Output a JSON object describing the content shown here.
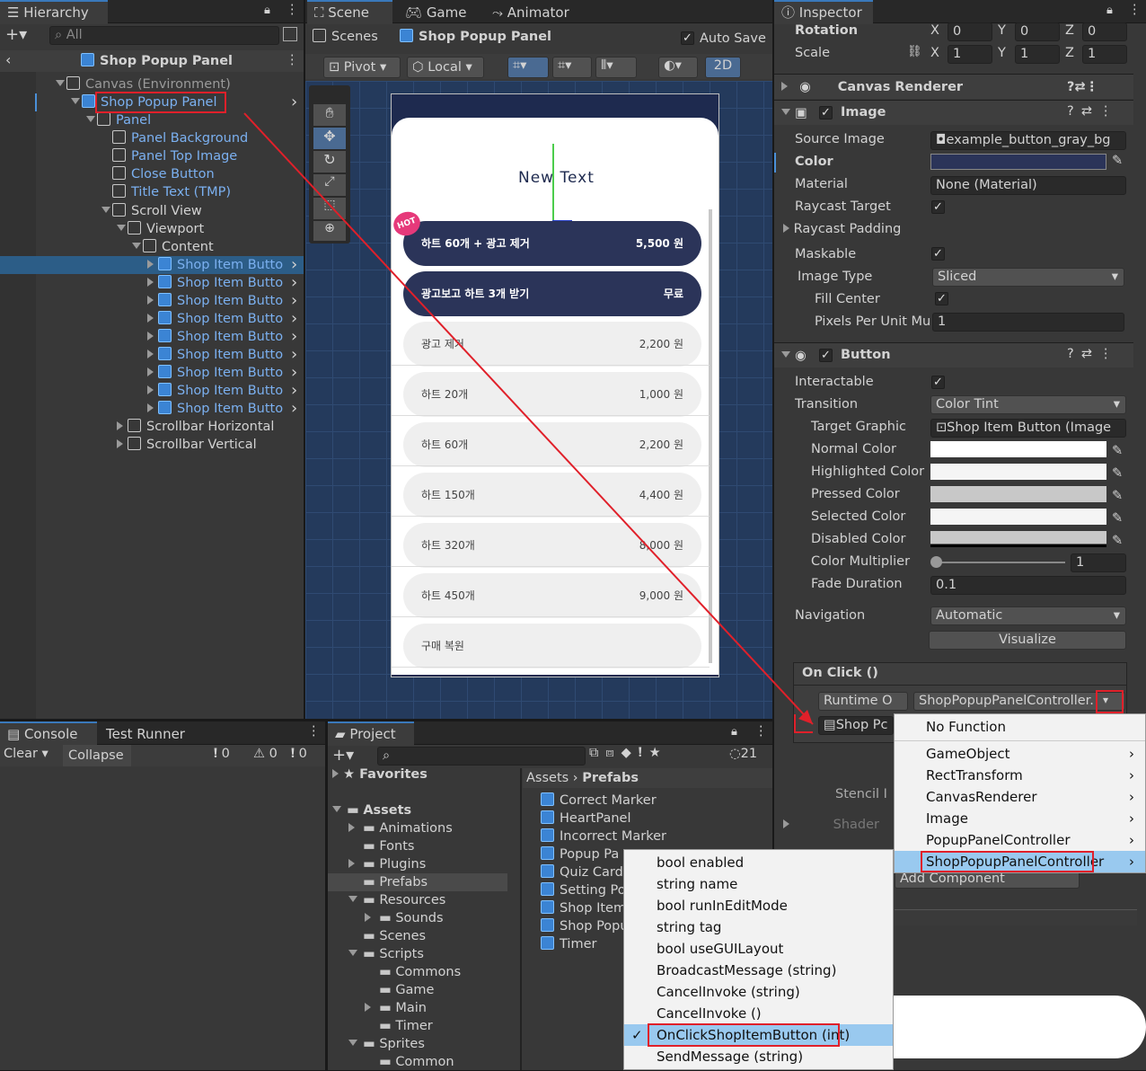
{
  "hierarchy": {
    "tab": "Hierarchy",
    "search": "All",
    "root": "Shop Popup Panel",
    "items": [
      {
        "label": "Canvas (Environment)",
        "depth": 0
      },
      {
        "label": "Shop Popup Panel",
        "depth": 1
      },
      {
        "label": "Panel",
        "depth": 2
      },
      {
        "label": "Panel Background",
        "depth": 3
      },
      {
        "label": "Panel Top Image",
        "depth": 3
      },
      {
        "label": "Close Button",
        "depth": 3
      },
      {
        "label": "Title Text (TMP)",
        "depth": 3
      },
      {
        "label": "Scroll View",
        "depth": 3
      },
      {
        "label": "Viewport",
        "depth": 4
      },
      {
        "label": "Content",
        "depth": 5
      },
      {
        "label": "Shop Item Butto",
        "depth": 6
      },
      {
        "label": "Shop Item Butto",
        "depth": 6
      },
      {
        "label": "Shop Item Butto",
        "depth": 6
      },
      {
        "label": "Shop Item Butto",
        "depth": 6
      },
      {
        "label": "Shop Item Butto",
        "depth": 6
      },
      {
        "label": "Shop Item Butto",
        "depth": 6
      },
      {
        "label": "Shop Item Butto",
        "depth": 6
      },
      {
        "label": "Shop Item Butto",
        "depth": 6
      },
      {
        "label": "Shop Item Butto",
        "depth": 6
      },
      {
        "label": "Scrollbar Horizontal",
        "depth": 4
      },
      {
        "label": "Scrollbar Vertical",
        "depth": 4
      }
    ]
  },
  "scene": {
    "tabs": [
      "Scene",
      "Game",
      "Animator"
    ],
    "breadcrumb_root": "Scenes",
    "breadcrumb": "Shop Popup Panel",
    "autosave": "Auto Save",
    "pivot": "Pivot",
    "local": "Local",
    "mode2d": "2D",
    "popup": {
      "title": "New Text",
      "badge": "HOT",
      "rows": [
        {
          "name": "하트 60개 + 광고 제거",
          "price": "5,500 원",
          "dark": true
        },
        {
          "name": "광고보고 하트 3개 받기",
          "price": "무료",
          "dark": true
        },
        {
          "name": "광고 제거",
          "price": "2,200 원",
          "dark": false
        },
        {
          "name": "하트 20개",
          "price": "1,000 원",
          "dark": false
        },
        {
          "name": "하트 60개",
          "price": "2,200 원",
          "dark": false
        },
        {
          "name": "하트 150개",
          "price": "4,400 원",
          "dark": false
        },
        {
          "name": "하트 320개",
          "price": "8,000 원",
          "dark": false
        },
        {
          "name": "하트 450개",
          "price": "9,000 원",
          "dark": false
        },
        {
          "name": "구매 복원",
          "price": "",
          "dark": false
        }
      ]
    }
  },
  "console": {
    "tabs": [
      "Console",
      "Test Runner"
    ],
    "clear": "Clear",
    "collapse": "Collapse",
    "counts": [
      "0",
      "0",
      "0"
    ]
  },
  "project": {
    "tab": "Project",
    "count": "21",
    "favorites": "Favorites",
    "path": [
      "Assets",
      "Prefabs"
    ],
    "tree": [
      {
        "label": "Assets",
        "d": 0
      },
      {
        "label": "Animations",
        "d": 1
      },
      {
        "label": "Fonts",
        "d": 1
      },
      {
        "label": "Plugins",
        "d": 1
      },
      {
        "label": "Prefabs",
        "d": 1
      },
      {
        "label": "Resources",
        "d": 1
      },
      {
        "label": "Sounds",
        "d": 2
      },
      {
        "label": "Scenes",
        "d": 1
      },
      {
        "label": "Scripts",
        "d": 1
      },
      {
        "label": "Commons",
        "d": 2
      },
      {
        "label": "Game",
        "d": 2
      },
      {
        "label": "Main",
        "d": 2
      },
      {
        "label": "Timer",
        "d": 2
      },
      {
        "label": "Sprites",
        "d": 1
      },
      {
        "label": "Common",
        "d": 2
      }
    ],
    "assets": [
      "Correct Marker",
      "HeartPanel",
      "Incorrect Marker",
      "Popup Pa",
      "Quiz Card",
      "Setting Po",
      "Shop Item",
      "Shop Popu",
      "Timer"
    ]
  },
  "inspector": {
    "tab": "Inspector",
    "rotation": {
      "label": "Rotation",
      "x": "0",
      "y": "0",
      "z": "0"
    },
    "scale": {
      "label": "Scale",
      "x": "1",
      "y": "1",
      "z": "1"
    },
    "canvas_renderer": "Canvas Renderer",
    "image": {
      "title": "Image",
      "source_label": "Source Image",
      "source": "example_button_gray_bg",
      "color_label": "Color",
      "material_label": "Material",
      "material": "None (Material)",
      "raycast_label": "Raycast Target",
      "padding_label": "Raycast Padding",
      "maskable_label": "Maskable",
      "type_label": "Image Type",
      "type": "Sliced",
      "fill_label": "Fill Center",
      "ppu_label": "Pixels Per Unit Mu",
      "ppu": "1"
    },
    "button": {
      "title": "Button",
      "interactable": "Interactable",
      "transition_label": "Transition",
      "transition": "Color Tint",
      "target_label": "Target Graphic",
      "target": "Shop Item Button (Image",
      "normal": "Normal Color",
      "highlighted": "Highlighted Color",
      "pressed": "Pressed Color",
      "selected": "Selected Color",
      "disabled": "Disabled Color",
      "multiplier_label": "Color Multiplier",
      "multiplier": "1",
      "fade_label": "Fade Duration",
      "fade": "0.1",
      "nav_label": "Navigation",
      "nav": "Automatic",
      "visualize": "Visualize",
      "onclick": "On Click ()",
      "runtime": "Runtime O",
      "function": "ShopPopupPanelController.",
      "object": "Shop Pc"
    },
    "stencil": "Stencil I",
    "shader": "Shader",
    "add_component": "Add Component"
  },
  "menu1": [
    "No Function",
    "GameObject",
    "RectTransform",
    "CanvasRenderer",
    "Image",
    "PopupPanelController",
    "ShopPopupPanelController"
  ],
  "menu2": [
    "bool enabled",
    "string name",
    "bool runInEditMode",
    "string tag",
    "bool useGUILayout",
    "BroadcastMessage (string)",
    "CancelInvoke (string)",
    "CancelInvoke ()",
    "OnClickShopItemButton (int)",
    "SendMessage (string)"
  ],
  "colors": {
    "accent": "#3a79bb",
    "highlight": "#99c9ef",
    "red": "#e0202a",
    "navy": "#2b3459"
  }
}
